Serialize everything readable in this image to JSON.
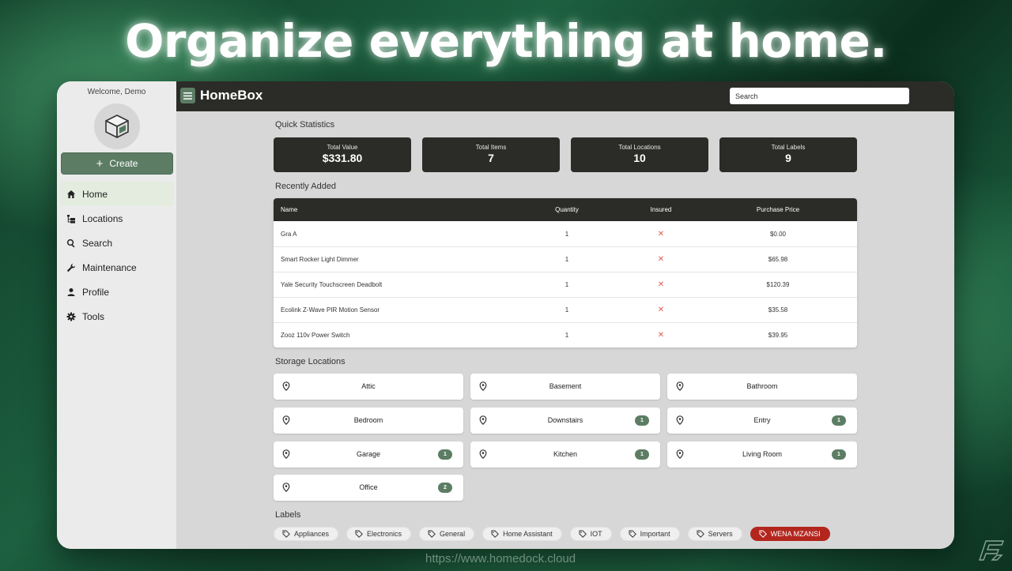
{
  "hero": {
    "headline": "Organize everything at home."
  },
  "footer": {
    "url": "https://www.homedock.cloud"
  },
  "sidebar": {
    "welcome": "Welcome, Demo",
    "create_label": "Create",
    "items": [
      {
        "label": "Home",
        "icon": "home-icon",
        "active": true
      },
      {
        "label": "Locations",
        "icon": "tree-icon"
      },
      {
        "label": "Search",
        "icon": "search-icon"
      },
      {
        "label": "Maintenance",
        "icon": "wrench-icon"
      },
      {
        "label": "Profile",
        "icon": "person-icon"
      },
      {
        "label": "Tools",
        "icon": "gear-icon"
      }
    ]
  },
  "topbar": {
    "brand": "HomeBox",
    "search_placeholder": "Search"
  },
  "stats": {
    "title": "Quick Statistics",
    "cards": [
      {
        "label": "Total Value",
        "value": "$331.80"
      },
      {
        "label": "Total Items",
        "value": "7"
      },
      {
        "label": "Total Locations",
        "value": "10"
      },
      {
        "label": "Total Labels",
        "value": "9"
      }
    ]
  },
  "recent": {
    "title": "Recently Added",
    "columns": {
      "name": "Name",
      "quantity": "Quantity",
      "insured": "Insured",
      "price": "Purchase Price"
    },
    "rows": [
      {
        "name": "Gra A",
        "quantity": "1",
        "insured": "✕",
        "price": "$0.00"
      },
      {
        "name": "Smart Rocker Light Dimmer",
        "quantity": "1",
        "insured": "✕",
        "price": "$65.98"
      },
      {
        "name": "Yale Security Touchscreen Deadbolt",
        "quantity": "1",
        "insured": "✕",
        "price": "$120.39"
      },
      {
        "name": "Ecolink Z-Wave PIR Motion Sensor",
        "quantity": "1",
        "insured": "✕",
        "price": "$35.58"
      },
      {
        "name": "Zooz 110v Power Switch",
        "quantity": "1",
        "insured": "✕",
        "price": "$39.95"
      }
    ]
  },
  "locations": {
    "title": "Storage Locations",
    "items": [
      {
        "name": "Attic",
        "count": ""
      },
      {
        "name": "Basement",
        "count": ""
      },
      {
        "name": "Bathroom",
        "count": ""
      },
      {
        "name": "Bedroom",
        "count": ""
      },
      {
        "name": "Downstairs",
        "count": "1"
      },
      {
        "name": "Entry",
        "count": "1"
      },
      {
        "name": "Garage",
        "count": "1"
      },
      {
        "name": "Kitchen",
        "count": "1"
      },
      {
        "name": "Living Room",
        "count": "1"
      },
      {
        "name": "Office",
        "count": "2"
      }
    ]
  },
  "labels": {
    "title": "Labels",
    "items": [
      {
        "name": "Appliances"
      },
      {
        "name": "Electronics"
      },
      {
        "name": "General"
      },
      {
        "name": "Home Assistant"
      },
      {
        "name": "IOT"
      },
      {
        "name": "Important"
      },
      {
        "name": "Servers"
      },
      {
        "name": "WENA MZANSI",
        "color": "#b3261e"
      }
    ]
  },
  "colors": {
    "accent": "#5c7d64",
    "dark": "#2b2b28",
    "danger": "#b3261e"
  }
}
